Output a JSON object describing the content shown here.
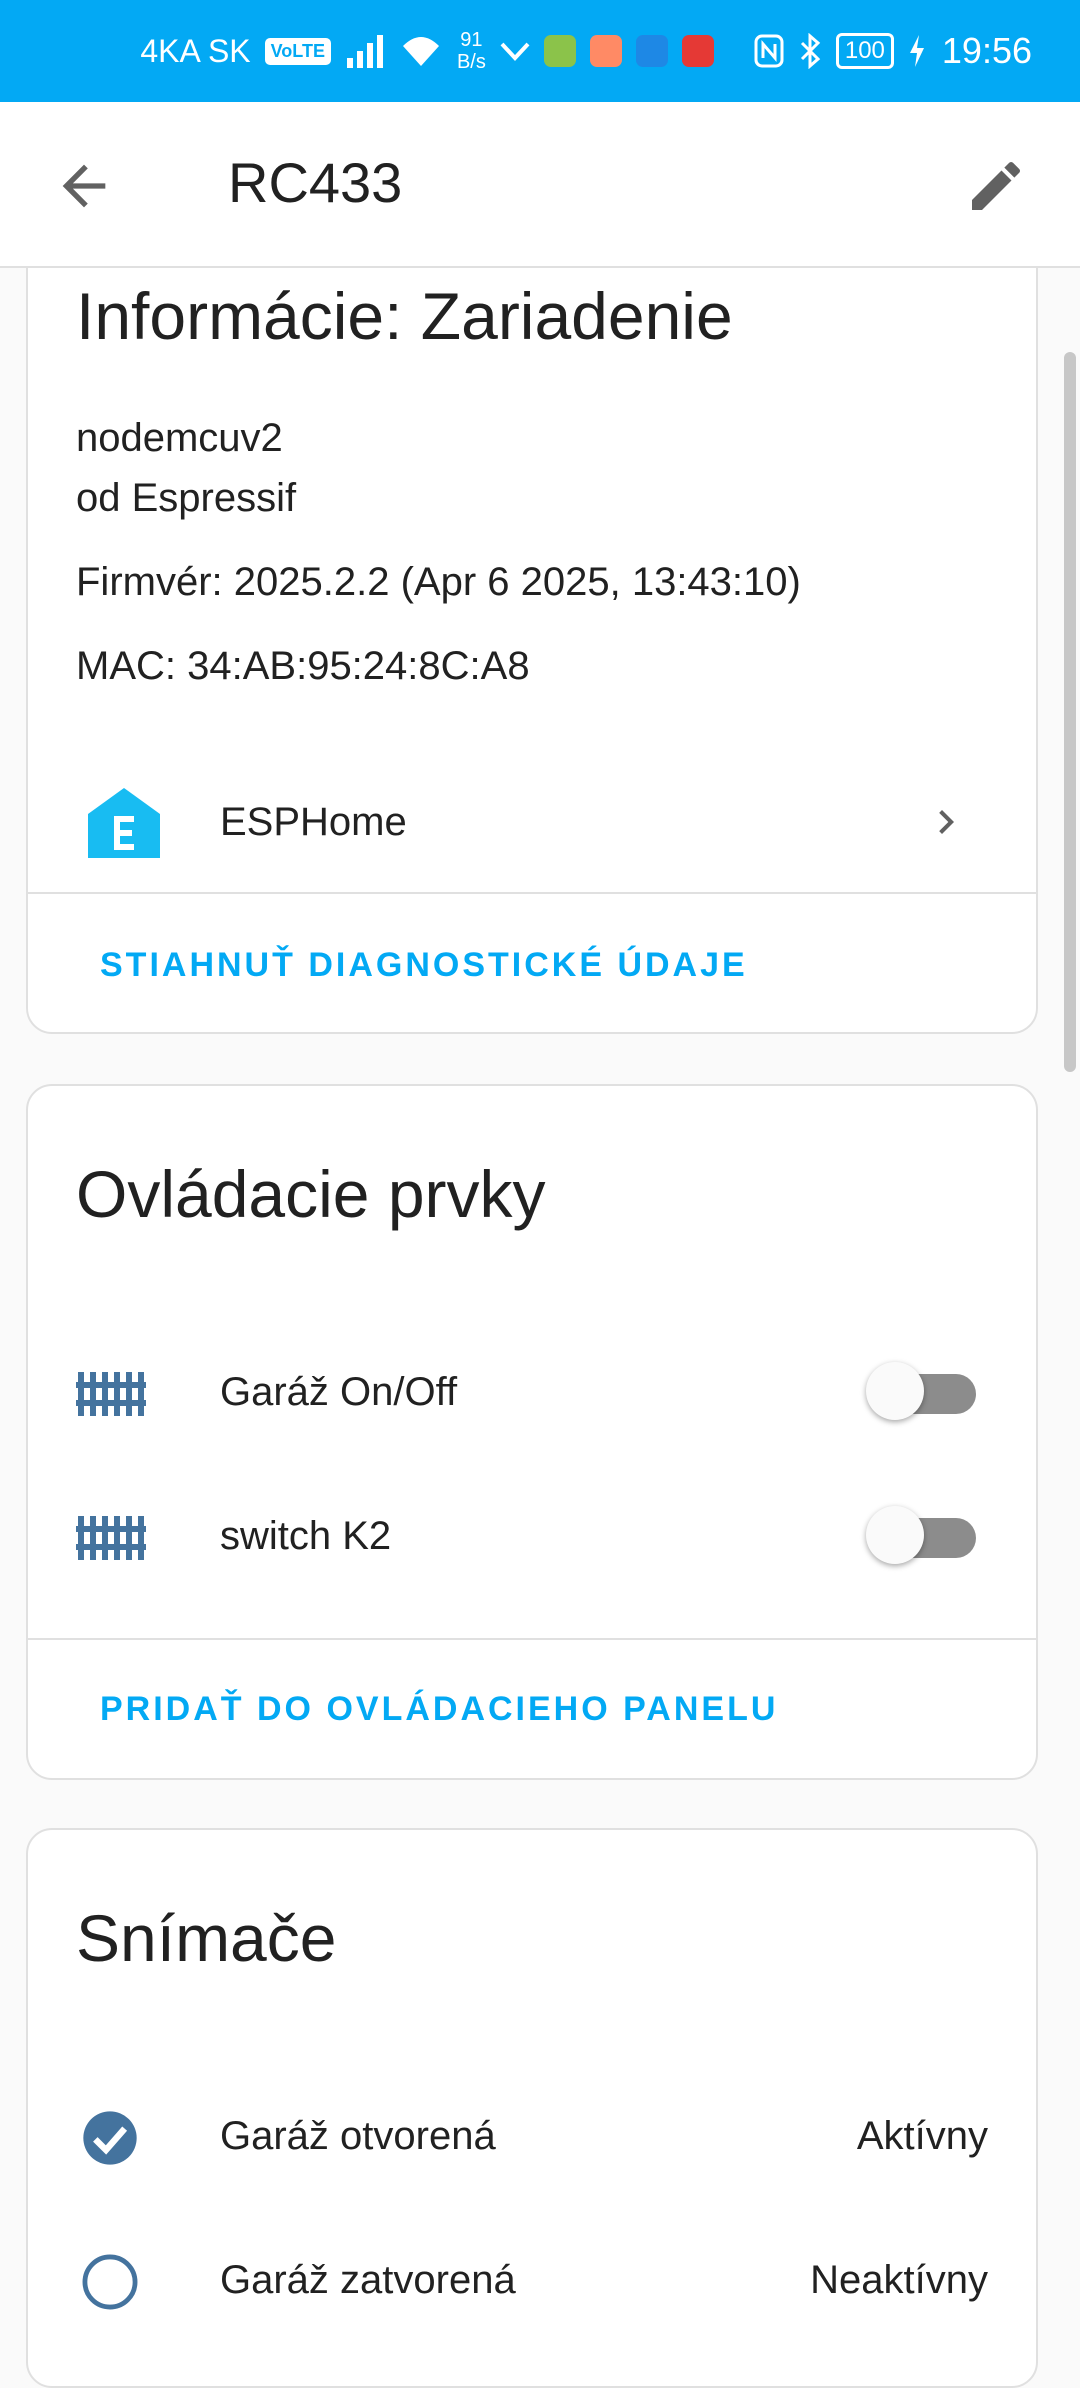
{
  "status_bar": {
    "carrier": "4KA SK",
    "volte": "VoLTE",
    "net_speed_value": "91",
    "net_speed_unit": "B/s",
    "battery": "100",
    "time": "19:56"
  },
  "app_bar": {
    "title": "RC433",
    "back_icon": "arrow-left-icon",
    "edit_icon": "pencil-icon"
  },
  "device_info": {
    "title": "Informácie: Zariadenie",
    "model": "nodemcuv2",
    "manufacturer": "od Espressif",
    "firmware": "Firmvér: 2025.2.2 (Apr 6 2025, 13:43:10)",
    "mac": "MAC: 34:AB:95:24:8C:A8",
    "integration": {
      "name": "ESPHome",
      "icon": "esphome-logo-icon"
    },
    "download_action": "STIAHNUŤ DIAGNOSTICKÉ ÚDAJE"
  },
  "controls": {
    "title": "Ovládacie prvky",
    "items": [
      {
        "label": "Garáž On/Off",
        "icon": "gate-icon",
        "on": false
      },
      {
        "label": "switch K2",
        "icon": "gate-icon",
        "on": false
      }
    ],
    "add_action": "PRIDAŤ DO OVLÁDACIEHO PANELU"
  },
  "sensors": {
    "title": "Snímače",
    "items": [
      {
        "label": "Garáž otvorená",
        "value": "Aktívny",
        "icon": "checkbox-marked-circle-icon"
      },
      {
        "label": "Garáž zatvorená",
        "value": "Neaktívny",
        "icon": "checkbox-blank-circle-outline-icon"
      }
    ]
  },
  "colors": {
    "status_bar": "#03a9f4",
    "accent": "#03a9f4",
    "icon_blue": "#44739e",
    "toggle_off_track": "#8c8c8c"
  }
}
